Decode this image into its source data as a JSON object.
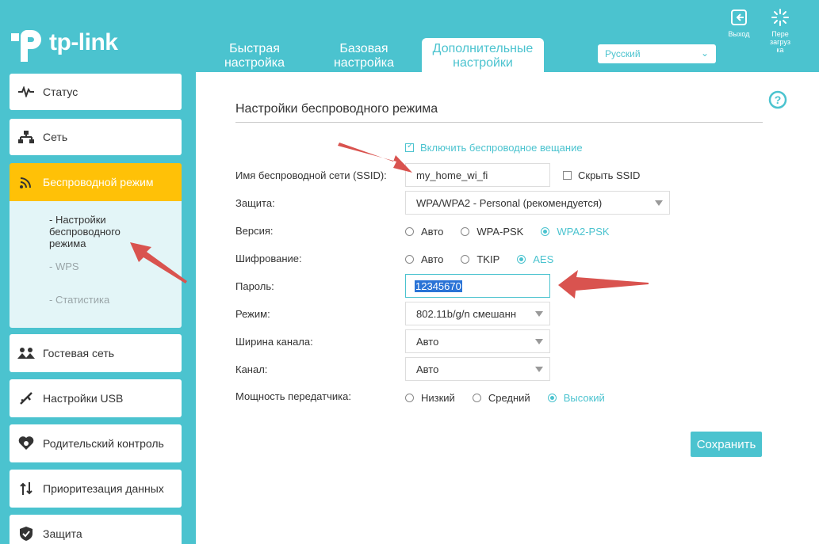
{
  "header": {
    "logo_text": "tp-link",
    "tabs": [
      {
        "label": "Быстрая настройка"
      },
      {
        "label": "Базовая настройка"
      },
      {
        "label": "Дополнительные настройки"
      }
    ],
    "language": "Русский",
    "logout_label": "Выход",
    "reboot_label": "Пере загруз ка"
  },
  "sidebar": {
    "items": [
      {
        "label": "Статус",
        "icon": "pulse-icon"
      },
      {
        "label": "Сеть",
        "icon": "network-icon"
      },
      {
        "label": "Беспроводной режим",
        "icon": "wifi-icon"
      },
      {
        "label": "Гостевая сеть",
        "icon": "guests-icon"
      },
      {
        "label": "Настройки USB",
        "icon": "usb-icon"
      },
      {
        "label": "Родительский контроль",
        "icon": "heart-icon"
      },
      {
        "label": "Приоритезация данных",
        "icon": "priority-icon"
      },
      {
        "label": "Защита",
        "icon": "shield-icon"
      }
    ],
    "submenu": [
      {
        "label": "- Настройки беспроводного режима"
      },
      {
        "label": "- WPS"
      },
      {
        "label": "- Статистика"
      }
    ]
  },
  "content": {
    "title": "Настройки беспроводного режима",
    "broadcast_label": "Включить беспроводное вещание",
    "ssid_label": "Имя беспроводной сети (SSID):",
    "ssid_value": "my_home_wi_fi",
    "hide_ssid_label": "Скрыть SSID",
    "security_label": "Защита:",
    "security_value": "WPA/WPA2 - Personal (рекомендуется)",
    "version_label": "Версия:",
    "version_options": [
      "Авто",
      "WPA-PSK",
      "WPA2-PSK"
    ],
    "encryption_label": "Шифрование:",
    "encryption_options": [
      "Авто",
      "TKIP",
      "AES"
    ],
    "password_label": "Пароль:",
    "password_value": "12345670",
    "mode_label": "Режим:",
    "mode_value": "802.11b/g/n смешанн",
    "width_label": "Ширина канала:",
    "width_value": "Авто",
    "channel_label": "Канал:",
    "channel_value": "Авто",
    "power_label": "Мощность передатчика:",
    "power_options": [
      "Низкий",
      "Средний",
      "Высокий"
    ],
    "save_label": "Сохранить"
  },
  "colors": {
    "accent": "#4bc3cf",
    "active_menu": "#ffc107",
    "annotation_arrow": "#d9534f"
  }
}
